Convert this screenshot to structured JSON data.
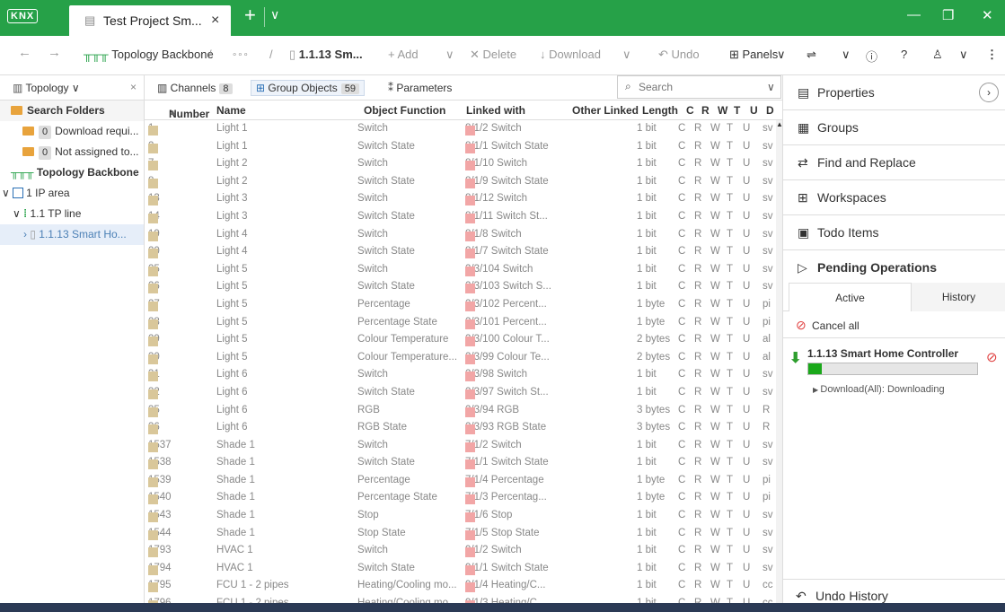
{
  "app": {
    "logo": "KNX",
    "tab_title": "Test Project Sm...",
    "new_tab": "+",
    "tab_dropdown": "∨",
    "close_tab": "×"
  },
  "window": {
    "minimize": "—",
    "restore": "❐",
    "close": "✕"
  },
  "toolbar": {
    "back": "←",
    "forward": "→",
    "topology": "Topology Backbone",
    "sep1": "/",
    "ellipsis": "∘∘∘",
    "sep2": "/",
    "device": "1.1.13 Sm...",
    "add": "+ Add",
    "add_drop": "∨",
    "delete": "✕ Delete",
    "download": "↓ Download",
    "download_drop": "∨",
    "undo": "↶ Undo",
    "panels": "⊞ Panels",
    "panels_drop": "∨",
    "more": "⋮"
  },
  "left": {
    "topology_label": "Topology",
    "dropdown": "∨",
    "close": "×",
    "search_folders": "Search Folders",
    "folder1_count": "0",
    "folder1_label": "Download requi...",
    "folder2_count": "0",
    "folder2_label": "Not assigned to...",
    "backbone": "Topology Backbone",
    "area": "1 IP area",
    "line": "1.1 TP line",
    "device": "1.1.13 Smart Ho..."
  },
  "center": {
    "tab_channels": "Channels",
    "channels_count": "8",
    "tab_group_objects": "Group Objects",
    "group_objects_count": "59",
    "tab_parameters": "Parameters",
    "search_placeholder": "Search",
    "headers": {
      "number": "Number",
      "name": "Name",
      "function": "Object Function",
      "linked": "Linked with",
      "other": "Other Linked",
      "length": "Length",
      "c": "C",
      "r": "R",
      "w": "W",
      "t": "T",
      "u": "U",
      "d": "D"
    },
    "rows": [
      [
        "1",
        "Light 1",
        "Switch",
        "8/1/2 Switch",
        "1 bit",
        "sv"
      ],
      [
        "2",
        "Light 1",
        "Switch State",
        "8/1/1 Switch State",
        "1 bit",
        "sv"
      ],
      [
        "7",
        "Light 2",
        "Switch",
        "8/1/10 Switch",
        "1 bit",
        "sv"
      ],
      [
        "8",
        "Light 2",
        "Switch State",
        "8/1/9 Switch State",
        "1 bit",
        "sv"
      ],
      [
        "13",
        "Light 3",
        "Switch",
        "8/1/12 Switch",
        "1 bit",
        "sv"
      ],
      [
        "14",
        "Light 3",
        "Switch State",
        "8/1/11 Switch St...",
        "1 bit",
        "sv"
      ],
      [
        "19",
        "Light 4",
        "Switch",
        "8/1/8 Switch",
        "1 bit",
        "sv"
      ],
      [
        "20",
        "Light 4",
        "Switch State",
        "8/1/7 Switch State",
        "1 bit",
        "sv"
      ],
      [
        "25",
        "Light 5",
        "Switch",
        "2/3/104 Switch",
        "1 bit",
        "sv"
      ],
      [
        "26",
        "Light 5",
        "Switch State",
        "2/3/103 Switch S...",
        "1 bit",
        "sv"
      ],
      [
        "27",
        "Light 5",
        "Percentage",
        "2/3/102 Percent...",
        "1 byte",
        "pi"
      ],
      [
        "28",
        "Light 5",
        "Percentage State",
        "2/3/101 Percent...",
        "1 byte",
        "pi"
      ],
      [
        "29",
        "Light 5",
        "Colour Temperature",
        "2/3/100 Colour T...",
        "2 bytes",
        "al"
      ],
      [
        "30",
        "Light 5",
        "Colour Temperature...",
        "2/3/99 Colour Te...",
        "2 bytes",
        "al"
      ],
      [
        "31",
        "Light 6",
        "Switch",
        "2/3/98 Switch",
        "1 bit",
        "sv"
      ],
      [
        "32",
        "Light 6",
        "Switch State",
        "2/3/97 Switch St...",
        "1 bit",
        "sv"
      ],
      [
        "35",
        "Light 6",
        "RGB",
        "2/3/94 RGB",
        "3 bytes",
        "R"
      ],
      [
        "36",
        "Light 6",
        "RGB State",
        "2/3/93 RGB State",
        "3 bytes",
        "R"
      ],
      [
        "1537",
        "Shade 1",
        "Switch",
        "7/1/2 Switch",
        "1 bit",
        "sv"
      ],
      [
        "1538",
        "Shade 1",
        "Switch State",
        "7/1/1 Switch State",
        "1 bit",
        "sv"
      ],
      [
        "1539",
        "Shade 1",
        "Percentage",
        "7/1/4 Percentage",
        "1 byte",
        "pi"
      ],
      [
        "1540",
        "Shade 1",
        "Percentage State",
        "7/1/3 Percentag...",
        "1 byte",
        "pi"
      ],
      [
        "1543",
        "Shade 1",
        "Stop",
        "7/1/6 Stop",
        "1 bit",
        "sv"
      ],
      [
        "1544",
        "Shade 1",
        "Stop State",
        "7/1/5 Stop State",
        "1 bit",
        "sv"
      ],
      [
        "1793",
        "HVAC 1",
        "Switch",
        "9/1/2 Switch",
        "1 bit",
        "sv"
      ],
      [
        "1794",
        "HVAC 1",
        "Switch State",
        "9/1/1 Switch State",
        "1 bit",
        "sv"
      ],
      [
        "1795",
        "FCU 1 - 2 pipes",
        "Heating/Cooling mo...",
        "9/1/4 Heating/C...",
        "1 bit",
        "cc"
      ],
      [
        "1796",
        "FCU 1 - 2 pipes",
        "Heating/Cooling mo...",
        "9/1/3 Heating/C...",
        "1 bit",
        "cc"
      ]
    ],
    "flags": {
      "c": "C",
      "r": "R",
      "w": "W",
      "t": "T",
      "u": "U"
    }
  },
  "right": {
    "properties": "Properties",
    "groups": "Groups",
    "find_replace": "Find and Replace",
    "workspaces": "Workspaces",
    "todo": "Todo Items",
    "pending": "Pending Operations",
    "tab_active": "Active",
    "tab_history": "History",
    "cancel_all": "Cancel all",
    "op_device": "1.1.13 Smart Home Controller",
    "op_progress": 0.08,
    "op_status": "Download(All): Downloading",
    "undo_history": "Undo History"
  },
  "colors": {
    "brand": "#26a148",
    "progress": "#1aa81a",
    "cancel": "#e04040"
  }
}
